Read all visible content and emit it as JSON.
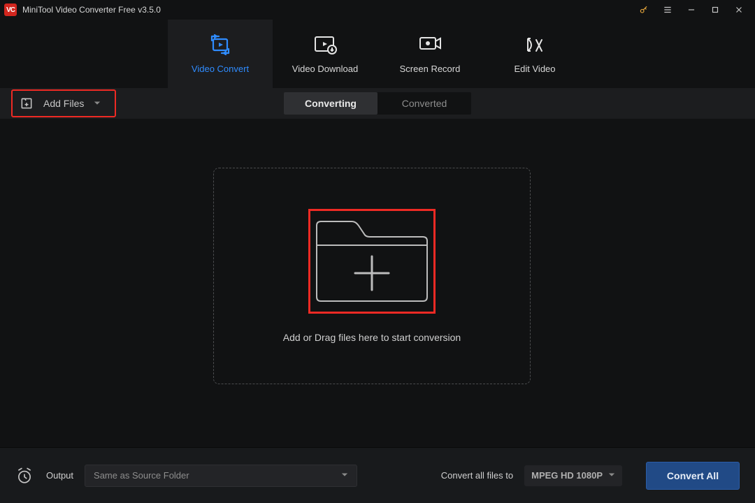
{
  "titlebar": {
    "title": "MiniTool Video Converter Free v3.5.0"
  },
  "nav": {
    "tabs": [
      {
        "label": "Video Convert"
      },
      {
        "label": "Video Download"
      },
      {
        "label": "Screen Record"
      },
      {
        "label": "Edit Video"
      }
    ]
  },
  "secondbar": {
    "add_files_label": "Add Files",
    "converting_label": "Converting",
    "converted_label": "Converted"
  },
  "drop": {
    "hint": "Add or Drag files here to start conversion"
  },
  "bottombar": {
    "output_label": "Output",
    "output_value": "Same as Source Folder",
    "convert_all_to_label": "Convert all files to",
    "format_value": "MPEG HD 1080P",
    "convert_all_button": "Convert All"
  },
  "highlight_color": "#ee2a24",
  "accent_color": "#2f8cff"
}
